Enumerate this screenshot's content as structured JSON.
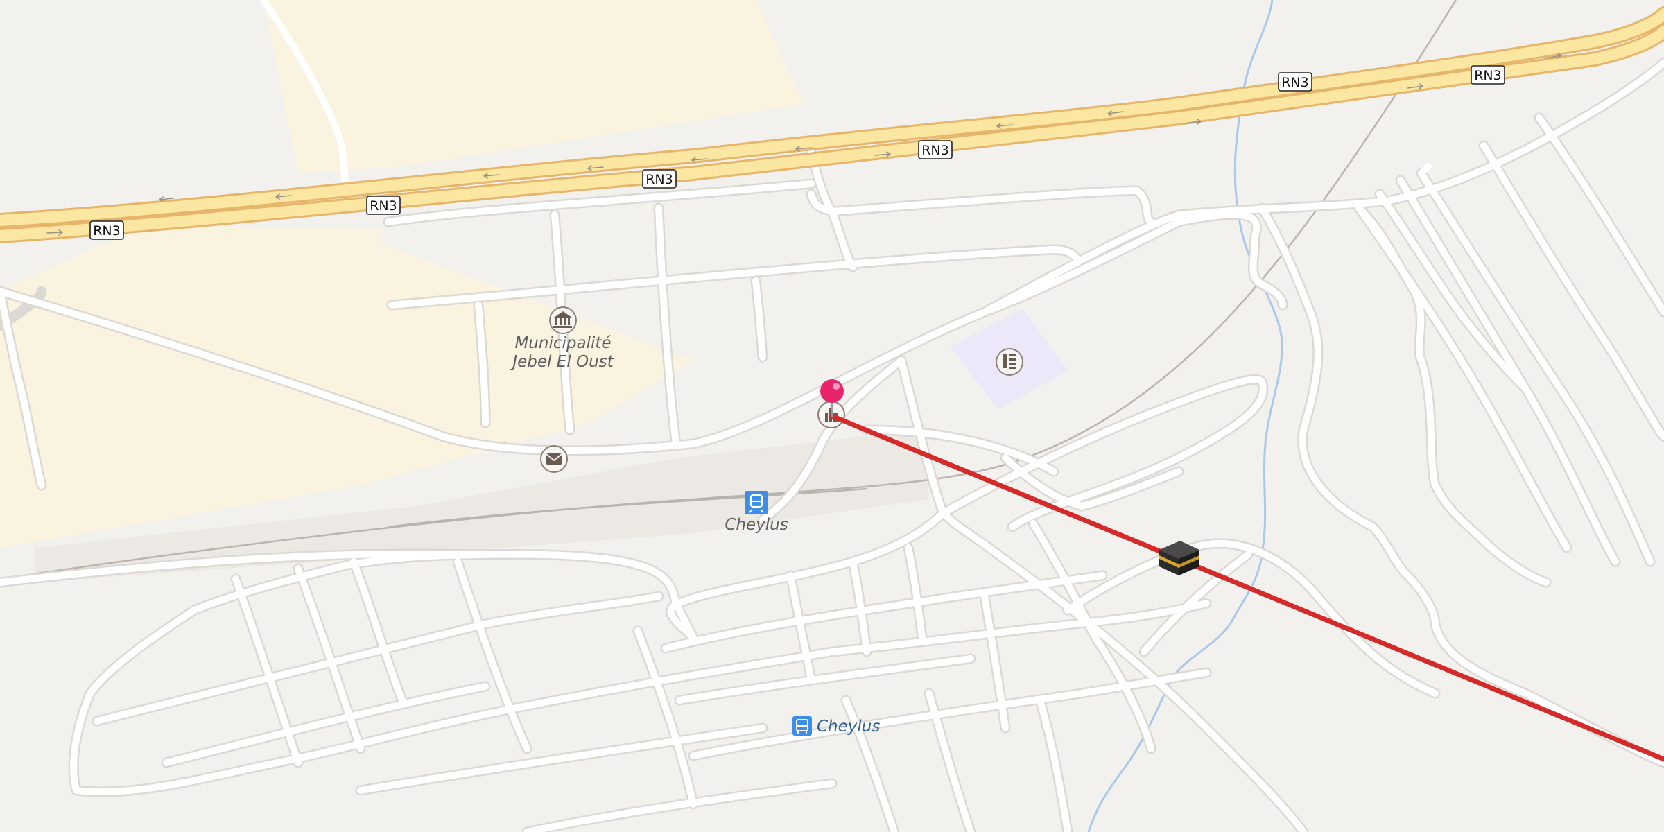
{
  "map": {
    "route_labels": [
      "RN3",
      "RN3",
      "RN3",
      "RN3",
      "RN3",
      "RN3"
    ],
    "places": {
      "municipality_line1": "Municipalité",
      "municipality_line2": "Jebel El Oust",
      "train_station": "Cheylus",
      "bus_stop": "Cheylus"
    },
    "icons": [
      "town-hall-icon",
      "post-office-icon",
      "school-icon",
      "factory-icon",
      "train-station-icon",
      "bus-stop-icon",
      "kaaba-mosque-icon",
      "location-pin-icon"
    ],
    "colors": {
      "background": "#f3f1ee",
      "road": "#ffffff",
      "road_casing": "#dcd8d3",
      "highway_fill": "#fbe6a2",
      "highway_casing": "#e6b56a",
      "farmland": "#faf3df",
      "school_area": "#ece8fa",
      "rail": "#b9b4ae",
      "river": "#a9c8ea",
      "route_line": "#d42a2a",
      "pin": "#e8246b",
      "transit": "#3d8ee8"
    }
  }
}
